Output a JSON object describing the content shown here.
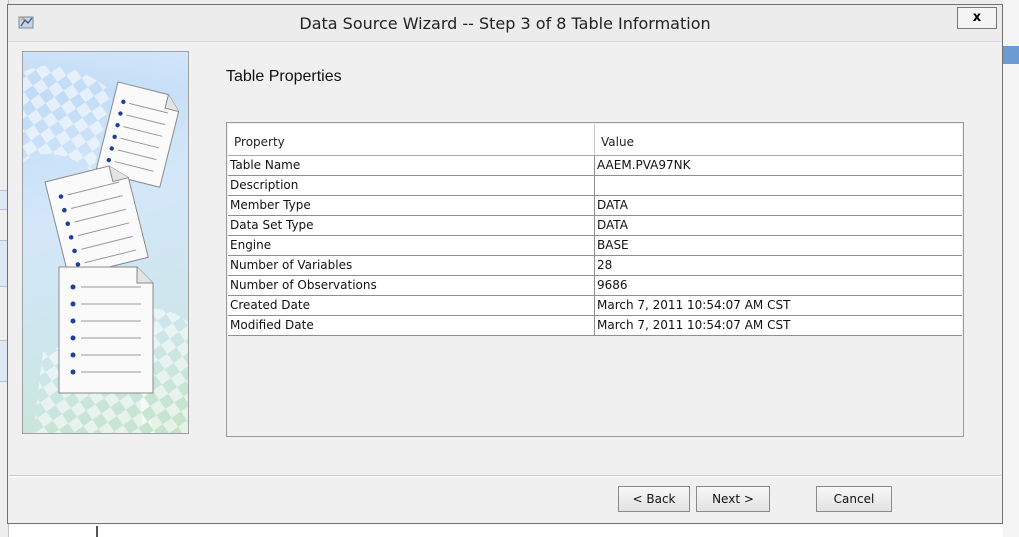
{
  "window": {
    "title": "Data Source Wizard  -- Step 3 of 8  Table Information",
    "close_label": "x"
  },
  "section": {
    "heading": "Table Properties"
  },
  "table": {
    "columns": [
      "Property",
      "Value"
    ],
    "rows": [
      {
        "property": "Table Name",
        "value": "AAEM.PVA97NK"
      },
      {
        "property": "Description",
        "value": ""
      },
      {
        "property": "Member Type",
        "value": "DATA"
      },
      {
        "property": "Data Set Type",
        "value": "DATA"
      },
      {
        "property": "Engine",
        "value": "BASE"
      },
      {
        "property": "Number of Variables",
        "value": "28"
      },
      {
        "property": "Number of Observations",
        "value": "9686"
      },
      {
        "property": "Created Date",
        "value": "March 7, 2011 10:54:07 AM CST"
      },
      {
        "property": "Modified Date",
        "value": "March 7, 2011 10:54:07 AM CST"
      }
    ]
  },
  "buttons": {
    "back": "< Back",
    "next": "Next >",
    "cancel": "Cancel"
  },
  "icons": {
    "app": "sas-miner-app-icon",
    "illustration": "document-list-illustration"
  }
}
